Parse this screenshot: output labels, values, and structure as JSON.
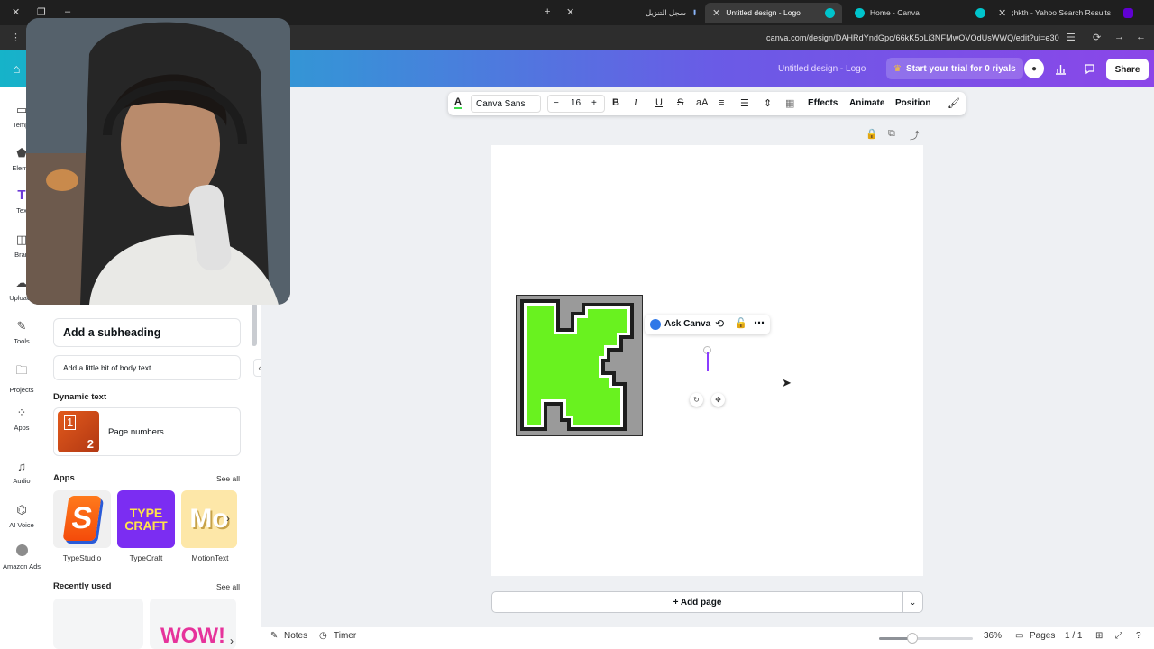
{
  "browser": {
    "tabs": [
      {
        "label": "سجل التنزيل",
        "active": false
      },
      {
        "label": "Untitled design - Logo",
        "active": true
      },
      {
        "label": "Home - Canva",
        "active": false
      },
      {
        "label": ";hkth - Yahoo Search Results",
        "active": false
      }
    ],
    "url": "canva.com/design/DAHRdYndGpc/66kK5oLi3NFMwOVOdUsWWQ/edit?ui=e30"
  },
  "header": {
    "doc_title": "Untitled design - Logo",
    "trial_label": "Start your trial for 0 riyals",
    "share_label": "Share"
  },
  "rail": {
    "items": [
      {
        "label": "Templ",
        "icon": "template-icon"
      },
      {
        "label": "Eleme",
        "icon": "elements-icon"
      },
      {
        "label": "Tex",
        "icon": "text-icon"
      },
      {
        "label": "Bran",
        "icon": "brand-icon"
      },
      {
        "label": "Uploads",
        "icon": "upload-icon"
      },
      {
        "label": "Tools",
        "icon": "tools-icon"
      },
      {
        "label": "Projects",
        "icon": "folder-icon"
      },
      {
        "label": "Apps",
        "icon": "apps-icon"
      },
      {
        "label": "Audio",
        "icon": "music-icon"
      },
      {
        "label": "AI Voice",
        "icon": "ai-voice-icon"
      },
      {
        "label": "Amazon Ads",
        "icon": "amazon-ads-icon"
      }
    ]
  },
  "panel": {
    "subheading": "Add a subheading",
    "body_text": "Add a little bit of body text",
    "dynamic_title": "Dynamic text",
    "page_numbers": "Page numbers",
    "page_numbers_tile": [
      "1",
      "2"
    ],
    "apps_title": "Apps",
    "see_all": "See all",
    "apps": [
      {
        "label": "TypeStudio",
        "tile_text": "S"
      },
      {
        "label": "TypeCraft",
        "tile_text": "TYPE CRAFT"
      },
      {
        "label": "MotionText",
        "tile_text": "Mo"
      }
    ],
    "recent_title": "Recently used",
    "recent": [
      {
        "tile_text": "WOW!"
      }
    ]
  },
  "toolbar": {
    "font": "Canva Sans",
    "size_minus": "−",
    "size": "16",
    "size_plus": "+",
    "bold": "B",
    "italic": "I",
    "underline": "U",
    "strike": "S",
    "case": "aA",
    "effects": "Effects",
    "animate": "Animate",
    "position": "Position"
  },
  "canvas": {
    "ask_canva": "Ask Canva",
    "add_page": "+ Add page"
  },
  "footer": {
    "notes": "Notes",
    "timer": "Timer",
    "zoom": "36%",
    "zoom_fraction": 0.36,
    "pages": "Pages",
    "page_count": "1 / 1"
  },
  "colors": {
    "logo_green": "#69f21f",
    "accent_purple": "#8b3dff",
    "header_gradient_start": "#16b3c9",
    "header_gradient_end": "#8b46e8"
  }
}
